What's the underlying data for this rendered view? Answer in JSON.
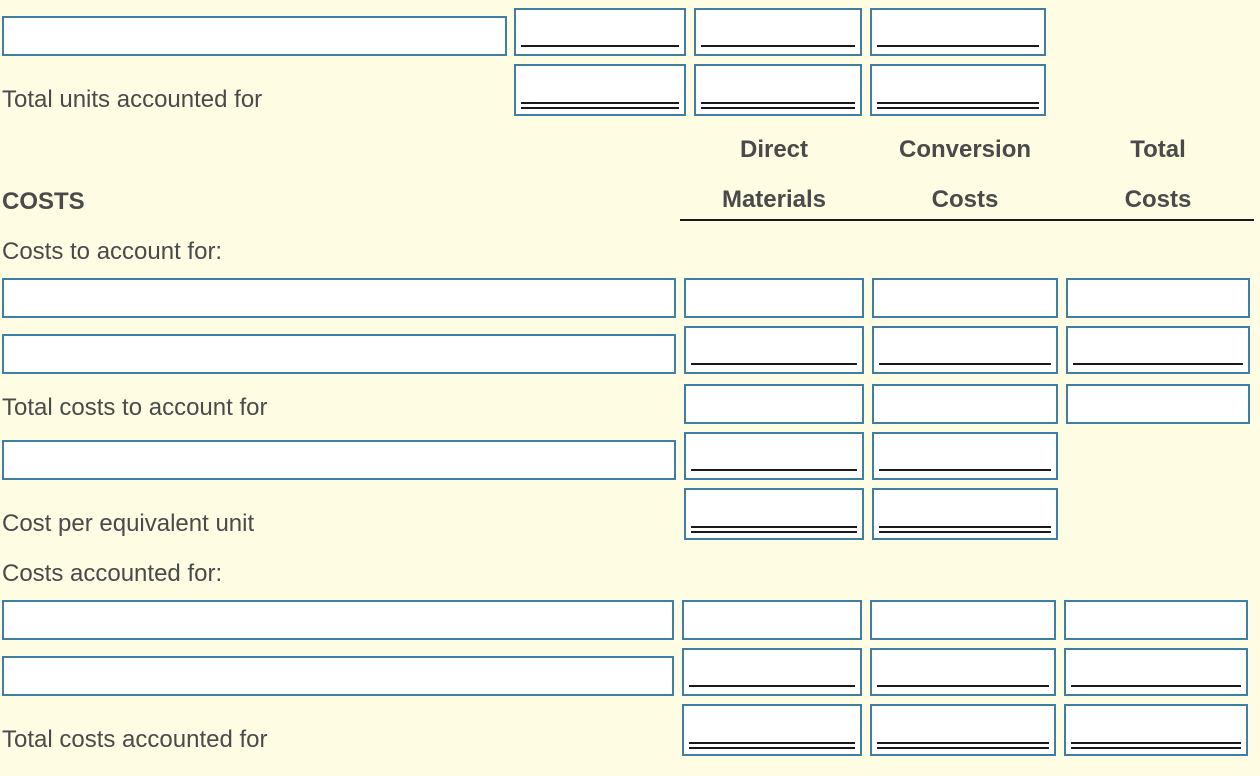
{
  "labels": {
    "total_units_accounted_for": "Total units accounted for",
    "costs_section": "COSTS",
    "costs_to_account_for": "Costs to account for:",
    "total_costs_to_account_for": "Total costs to account for",
    "cost_per_equivalent_unit": "Cost per equivalent unit",
    "costs_accounted_for": "Costs accounted for:",
    "total_costs_accounted_for": "Total costs accounted for"
  },
  "columns": {
    "direct_materials": [
      "Direct",
      "Materials"
    ],
    "conversion_costs": [
      "Conversion",
      "Costs"
    ],
    "total_costs": [
      "Total",
      "Costs"
    ]
  },
  "colors": {
    "background": "#fefde3",
    "input_border": "#3f7fa6",
    "text": "#4a4a4a"
  }
}
